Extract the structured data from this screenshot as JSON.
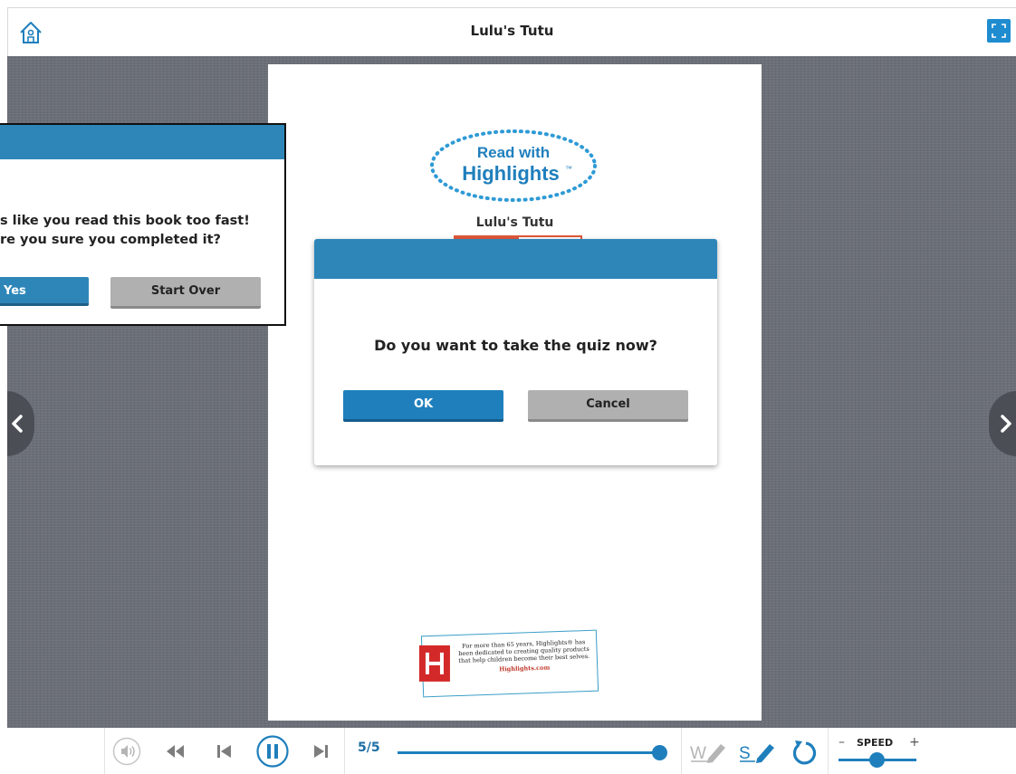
{
  "header": {
    "title": "Lulu's Tutu"
  },
  "page": {
    "logo_line1": "Read with",
    "logo_line2": "Highlights",
    "logo_tm": "™",
    "book_title": "Lulu's Tutu",
    "footer_text": "For more than 65 years, Highlights® has been dedicated to creating quality products that help children become their best selves.",
    "footer_link": "Highlights.com"
  },
  "quiz_dialog": {
    "message": "Do you want to take the quiz now?",
    "ok_label": "OK",
    "cancel_label": "Cancel"
  },
  "fast_dialog": {
    "line1": "s like you read this book too fast!",
    "line2": "re you sure you completed it?",
    "yes_label": "Yes",
    "start_over_label": "Start Over"
  },
  "player": {
    "page_count": "5/5",
    "progress": 1.0,
    "speed_label": "SPEED",
    "speed_minus": "–",
    "speed_plus": "+",
    "speed_value": 0.5,
    "word_highlight_label": "W",
    "sentence_highlight_label": "S"
  },
  "colors": {
    "accent": "#1f7fbc",
    "dialog_header": "#2e86b8",
    "stage": "#6b6f77"
  }
}
